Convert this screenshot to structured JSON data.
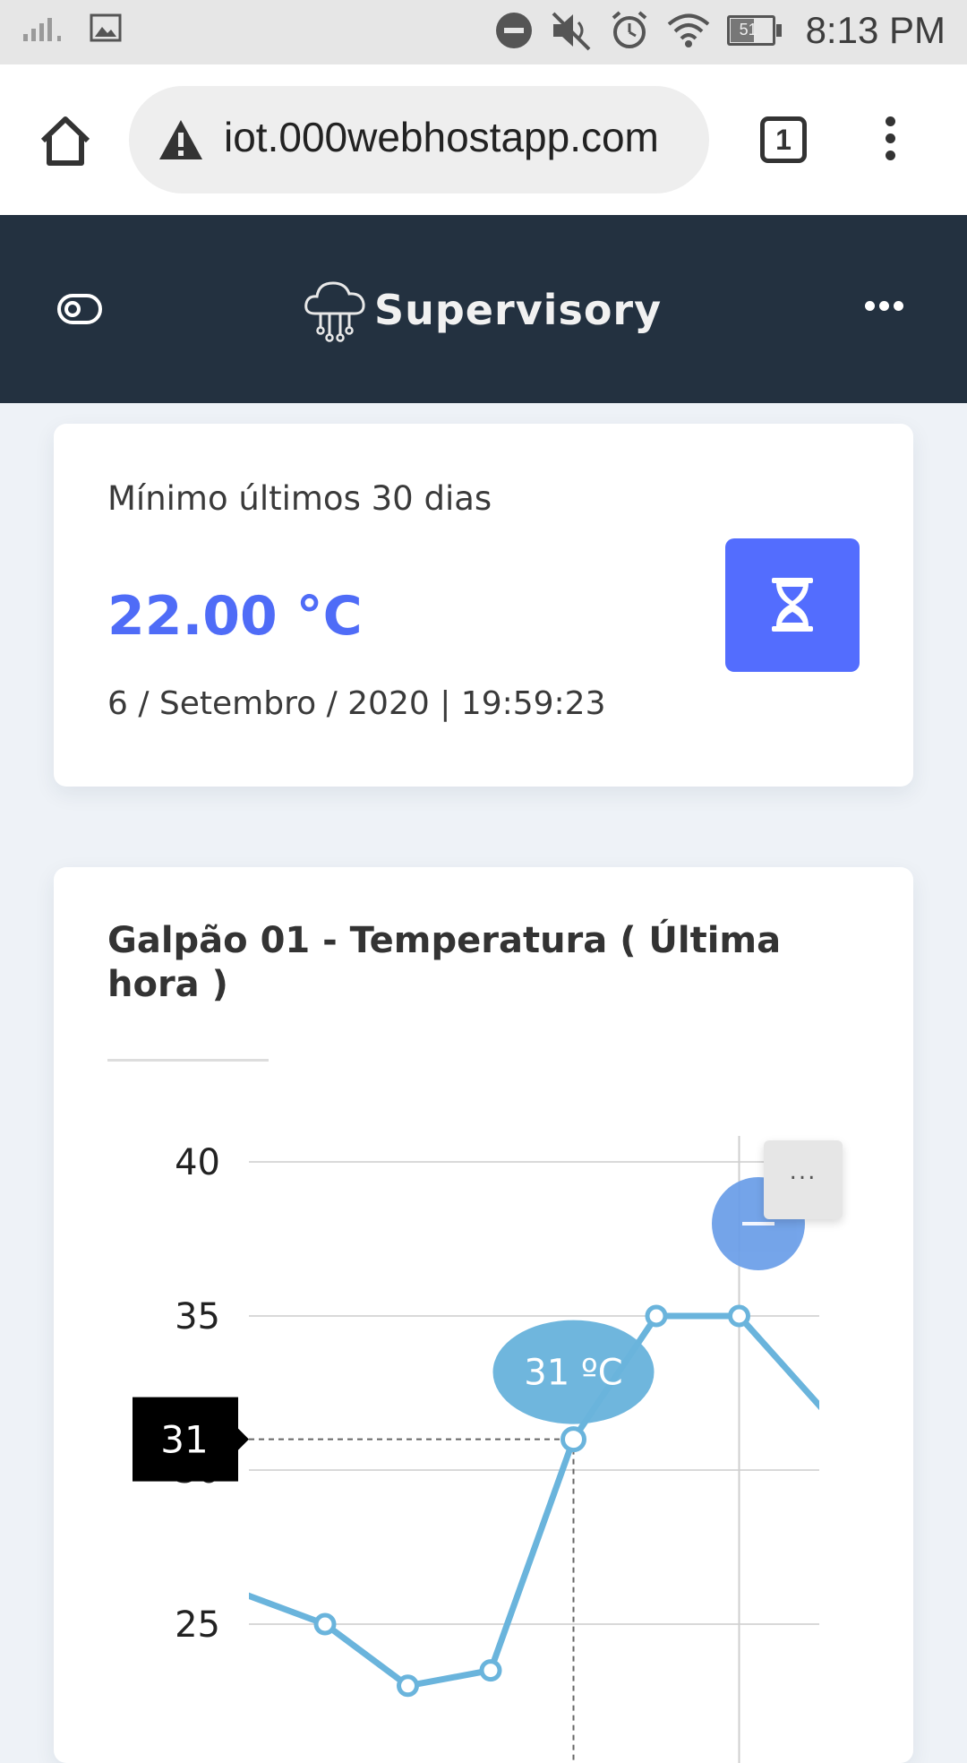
{
  "status_bar": {
    "time": "8:13 PM",
    "battery": "51",
    "icons": [
      "signal-icon",
      "gallery-icon",
      "do-not-disturb-icon",
      "mute-icon",
      "alarm-icon",
      "wifi-icon",
      "battery-icon"
    ]
  },
  "browser": {
    "url": "iot.000webhostapp.com",
    "tab_count": "1",
    "icons": [
      "home-icon",
      "warning-icon",
      "tabs-icon",
      "kebab-menu-icon"
    ]
  },
  "app_header": {
    "title": "Supervisory",
    "icons": [
      "toggle-icon",
      "cloud-logo-icon",
      "more-icon"
    ],
    "background": "#233140"
  },
  "min_card": {
    "label": "Mínimo últimos 30 dias",
    "value": "22.00 °C",
    "date": "6 / Setembro / 2020 | 19:59:23",
    "button_icon": "hourglass-icon",
    "accent": "#536dfe"
  },
  "chart_card": {
    "title": "Galpão 01 - Temperatura ( Última hora )",
    "menu_label": "...",
    "zoom_icon": "zoom-out-icon"
  },
  "chart_data": {
    "type": "line",
    "title": "Galpão 01 - Temperatura ( Última hora )",
    "y_ticks": [
      "40",
      "35",
      "30",
      "25"
    ],
    "ylim": [
      20,
      40
    ],
    "series": [
      {
        "color": "#6ab4dc",
        "values": [
          26.5,
          26,
          25,
          23,
          23.5,
          31,
          35,
          35,
          32
        ]
      }
    ],
    "crosshair": {
      "point_index": 5,
      "y_value_label": "31",
      "tooltip": "31 ºC"
    },
    "grid": true
  }
}
